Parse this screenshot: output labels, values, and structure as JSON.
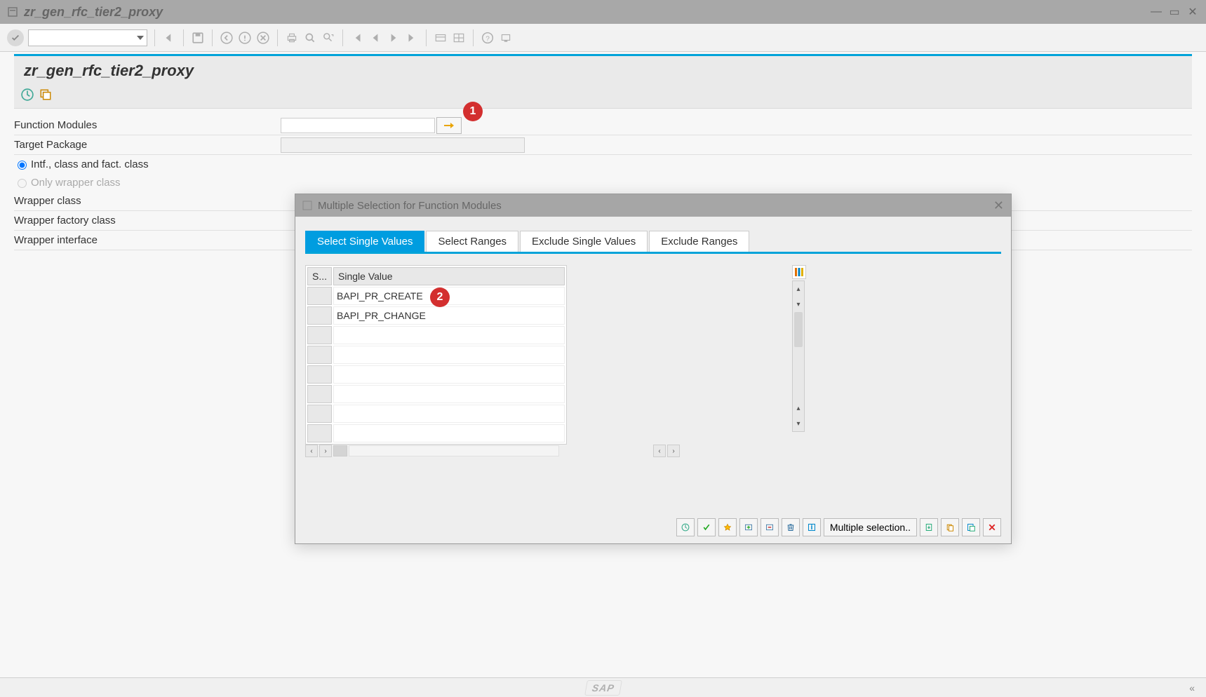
{
  "window": {
    "title": "zr_gen_rfc_tier2_proxy"
  },
  "header": {
    "title": "zr_gen_rfc_tier2_proxy"
  },
  "form": {
    "function_modules_label": "Function Modules",
    "function_modules_value": "",
    "target_package_label": "Target Package",
    "target_package_value": "",
    "radio_all_label": "Intf., class and fact. class",
    "radio_wrapper_only_label": "Only wrapper class",
    "wrapper_class_label": "Wrapper class",
    "wrapper_factory_label": "Wrapper factory class",
    "wrapper_interface_label": "Wrapper interface"
  },
  "dialog": {
    "title": "Multiple Selection for Function Modules",
    "tabs": [
      "Select Single Values",
      "Select Ranges",
      "Exclude Single Values",
      "Exclude Ranges"
    ],
    "active_tab": 0,
    "columns": {
      "col1": "S...",
      "col2": "Single Value"
    },
    "rows": [
      "BAPI_PR_CREATE",
      "BAPI_PR_CHANGE",
      "",
      "",
      "",
      "",
      "",
      ""
    ],
    "footer_multi_label": "Multiple selection.."
  },
  "annotations": {
    "one": "1",
    "two": "2"
  },
  "footer": {
    "brand": "SAP"
  }
}
